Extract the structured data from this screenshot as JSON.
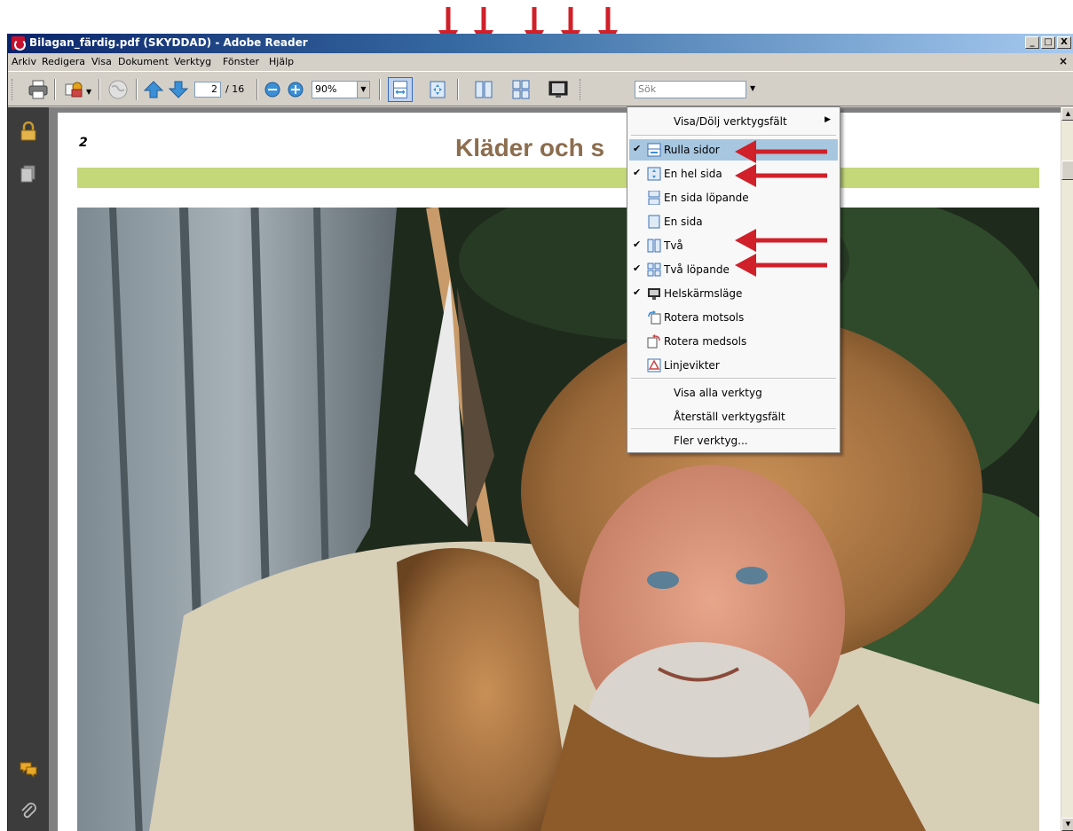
{
  "window": {
    "title": "Bilagan_färdig.pdf (SKYDDAD) - Adobe Reader",
    "minimize": "_",
    "maximize": "□",
    "close": "X"
  },
  "menubar": {
    "items": [
      "Arkiv",
      "Redigera",
      "Visa",
      "Dokument",
      "Verktyg",
      "Fönster",
      "Hjälp"
    ],
    "doc_close": "×"
  },
  "toolbar": {
    "page_current": "2",
    "page_total": "/ 16",
    "zoom": "90%",
    "search_placeholder": "Sök",
    "icons": [
      "print-icon",
      "email-icon",
      "globe-icon",
      "previous-page-icon",
      "next-page-icon",
      "zoom-out-icon",
      "zoom-in-icon",
      "scrolling-pages-icon",
      "fit-page-icon",
      "two-up-icon",
      "two-up-continuous-icon",
      "full-screen-icon"
    ]
  },
  "navpanel": {
    "icons": [
      "lock-icon",
      "pages-icon",
      "comments-icon",
      "attachment-icon"
    ]
  },
  "document": {
    "page_number": "2",
    "heading": "Kläder och s",
    "band_color": "#c4d779",
    "heading_color": "#8c6d4e"
  },
  "context_menu": {
    "header": "Visa/Dölj verktygsfält",
    "items": [
      {
        "label": "Rulla sidor",
        "checked": true,
        "highlighted": true,
        "icon": "scrolling-pages-icon"
      },
      {
        "label": "En hel sida",
        "checked": true,
        "icon": "fit-page-icon"
      },
      {
        "label": "En sida löpande",
        "checked": false,
        "icon": "single-continuous-icon"
      },
      {
        "label": "En sida",
        "checked": false,
        "icon": "single-page-icon"
      },
      {
        "label": "Två",
        "checked": true,
        "icon": "two-up-icon"
      },
      {
        "label": "Två löpande",
        "checked": true,
        "icon": "two-up-continuous-icon"
      },
      {
        "label": "Helskärmsläge",
        "checked": true,
        "icon": "full-screen-icon"
      },
      {
        "label": "Rotera motsols",
        "checked": false,
        "icon": "rotate-ccw-icon"
      },
      {
        "label": "Rotera medsols",
        "checked": false,
        "icon": "rotate-cw-icon"
      },
      {
        "label": "Linjevikter",
        "checked": false,
        "icon": "line-weights-icon"
      }
    ],
    "show_all": "Visa alla verktyg",
    "reset": "Återställ verktygsfält",
    "more": "Fler verktyg...",
    "checkmark": "✔"
  },
  "annotation_color": "#d0202a"
}
